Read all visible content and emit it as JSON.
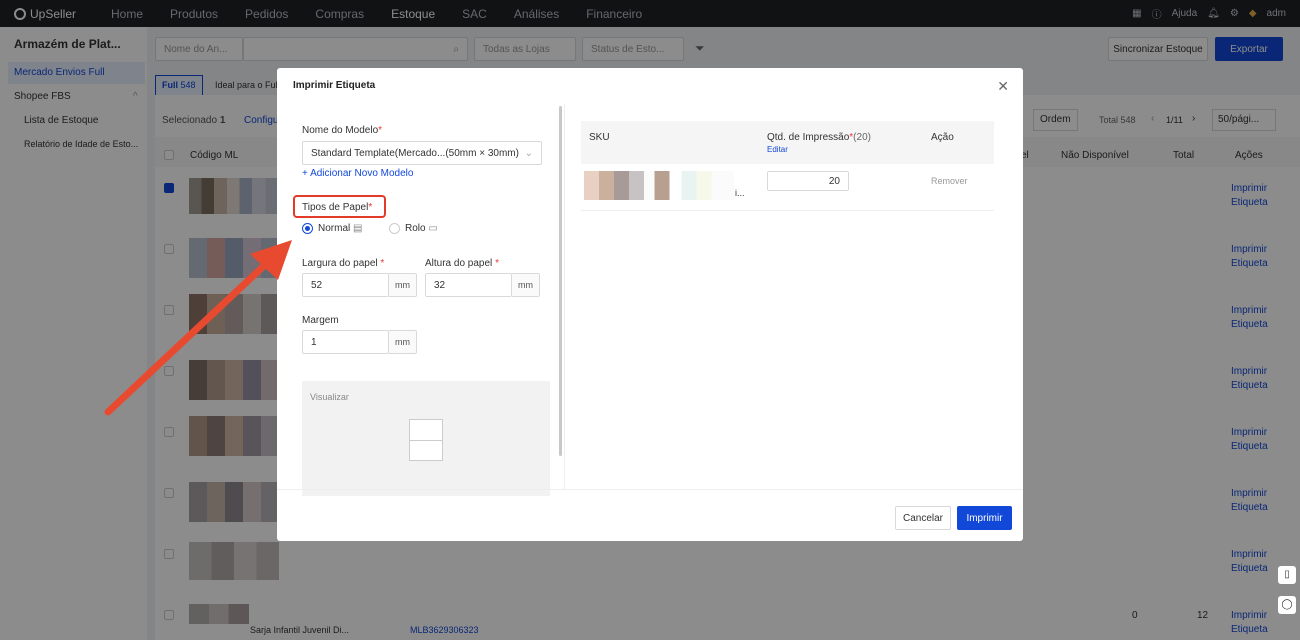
{
  "topbar": {
    "brand": "UpSeller",
    "nav": [
      "Home",
      "Produtos",
      "Pedidos",
      "Compras",
      "Estoque",
      "SAC",
      "Análises",
      "Financeiro"
    ],
    "active_nav": "Estoque",
    "help": "Ajuda",
    "user": "adm"
  },
  "sidebar": {
    "title": "Armazém de Plat...",
    "items": [
      {
        "label": "Mercado Envios Full",
        "active": true
      },
      {
        "label": "Shopee FBS",
        "active": false
      },
      {
        "label": "Lista de Estoque",
        "active": false
      },
      {
        "label": "Relatório de Idade de Esto...",
        "active": false
      }
    ]
  },
  "filters": {
    "search_field": "Nome do An...",
    "stores": "Todas as Lojas",
    "status": "Status de Esto..."
  },
  "toolbar": {
    "sync": "Sincronizar Estoque",
    "export": "Exportar",
    "tab_full": "Full",
    "tab_full_count": "548",
    "tab_ideal": "Ideal para o Full",
    "selected_label": "Selecionado",
    "selected_count": "1",
    "config": "Configu",
    "order": "Ordem",
    "total": "Total 548",
    "page": "1/11",
    "page_size": "50/pági..."
  },
  "table": {
    "headers": {
      "code": "Código ML",
      "unavailable": "Não Disponível",
      "total": "Total",
      "actions": "Ações",
      "partial": "el"
    },
    "row_action": "Imprimir Etiqueta",
    "last_row": {
      "unavailable": "0",
      "total": "12",
      "title": "Sarja Infantil Juvenil Di...",
      "code": "MLB3629306323"
    }
  },
  "modal": {
    "title": "Imprimir Etiqueta",
    "model_label": "Nome do Modelo",
    "model_value": "Standard Template(Mercado...(50mm × 30mm)",
    "add_model": "+ Adicionar Novo Modelo",
    "paper_type_label": "Tipos de Papel",
    "paper_normal": "Normal",
    "paper_roll": "Rolo",
    "width_label": "Largura do papel",
    "width_value": "52",
    "height_label": "Altura do papel",
    "height_value": "32",
    "margin_label": "Margem",
    "margin_value": "1",
    "unit": "mm",
    "preview_label": "Visualizar",
    "sku_header": "SKU",
    "qty_header": "Qtd. de Impressão",
    "qty_count": "(20)",
    "qty_edit": "Editar",
    "action_header": "Ação",
    "qty_value": "20",
    "remove": "Remover",
    "sku_suffix": "i...",
    "cancel": "Cancelar",
    "print": "Imprimir"
  },
  "colors": {
    "accent": "#1248d8",
    "highlight": "#e23b2a",
    "topbar": "#1f2126"
  }
}
